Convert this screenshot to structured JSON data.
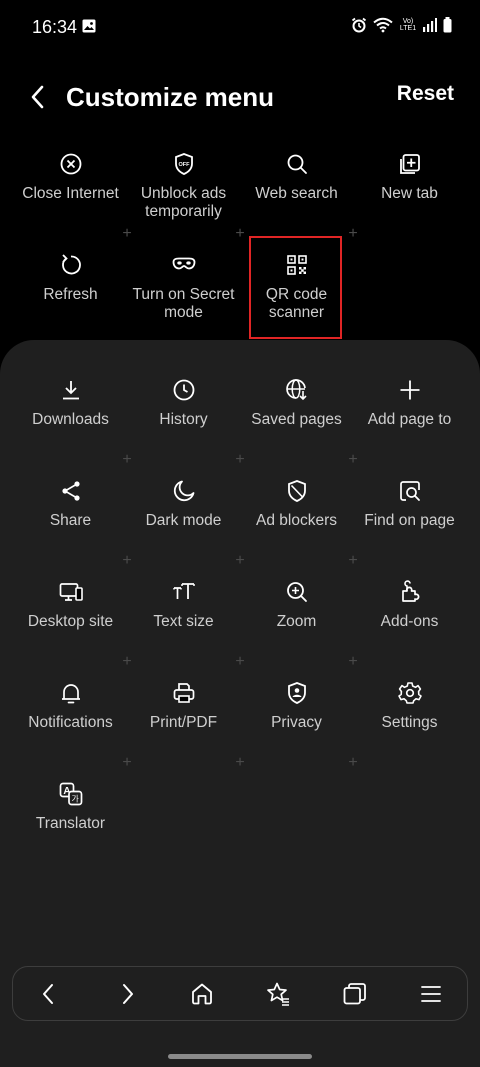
{
  "status_bar": {
    "time": "16:34",
    "network": "Vo) LTE1"
  },
  "header": {
    "title": "Customize menu",
    "reset_label": "Reset"
  },
  "active_items": [
    {
      "label": "Close Internet",
      "icon": "close-circle-icon"
    },
    {
      "label": "Unblock ads temporarily",
      "icon": "ads-off-shield-icon"
    },
    {
      "label": "Web search",
      "icon": "search-icon"
    },
    {
      "label": "New tab",
      "icon": "new-tab-icon"
    },
    {
      "label": "Refresh",
      "icon": "refresh-icon"
    },
    {
      "label": "Turn on Secret mode",
      "icon": "secret-mode-mask-icon"
    },
    {
      "label": "QR code scanner",
      "icon": "qr-code-icon"
    }
  ],
  "available_items": [
    {
      "label": "Downloads",
      "icon": "download-icon"
    },
    {
      "label": "History",
      "icon": "clock-icon"
    },
    {
      "label": "Saved pages",
      "icon": "globe-download-icon"
    },
    {
      "label": "Add page to",
      "icon": "plus-icon"
    },
    {
      "label": "Share",
      "icon": "share-icon"
    },
    {
      "label": "Dark mode",
      "icon": "moon-icon"
    },
    {
      "label": "Ad blockers",
      "icon": "shield-icon"
    },
    {
      "label": "Find on page",
      "icon": "find-page-icon"
    },
    {
      "label": "Desktop site",
      "icon": "desktop-icon"
    },
    {
      "label": "Text size",
      "icon": "text-size-icon"
    },
    {
      "label": "Zoom",
      "icon": "zoom-in-icon"
    },
    {
      "label": "Add-ons",
      "icon": "puzzle-icon"
    },
    {
      "label": "Notifications",
      "icon": "bell-icon"
    },
    {
      "label": "Print/PDF",
      "icon": "printer-icon"
    },
    {
      "label": "Privacy",
      "icon": "privacy-shield-icon"
    },
    {
      "label": "Settings",
      "icon": "gear-icon"
    },
    {
      "label": "Translator",
      "icon": "translate-icon"
    }
  ],
  "bottom_nav": [
    {
      "label": "Back",
      "icon": "chevron-left-icon"
    },
    {
      "label": "Forward",
      "icon": "chevron-right-icon"
    },
    {
      "label": "Home",
      "icon": "home-icon"
    },
    {
      "label": "Bookmarks",
      "icon": "star-list-icon"
    },
    {
      "label": "Tabs",
      "icon": "tabs-icon"
    },
    {
      "label": "Menu",
      "icon": "hamburger-menu-icon"
    }
  ],
  "colors": {
    "background": "#000000",
    "panel": "#1f1f1f",
    "highlight": "#e02525",
    "label": "#cfcfcf"
  }
}
